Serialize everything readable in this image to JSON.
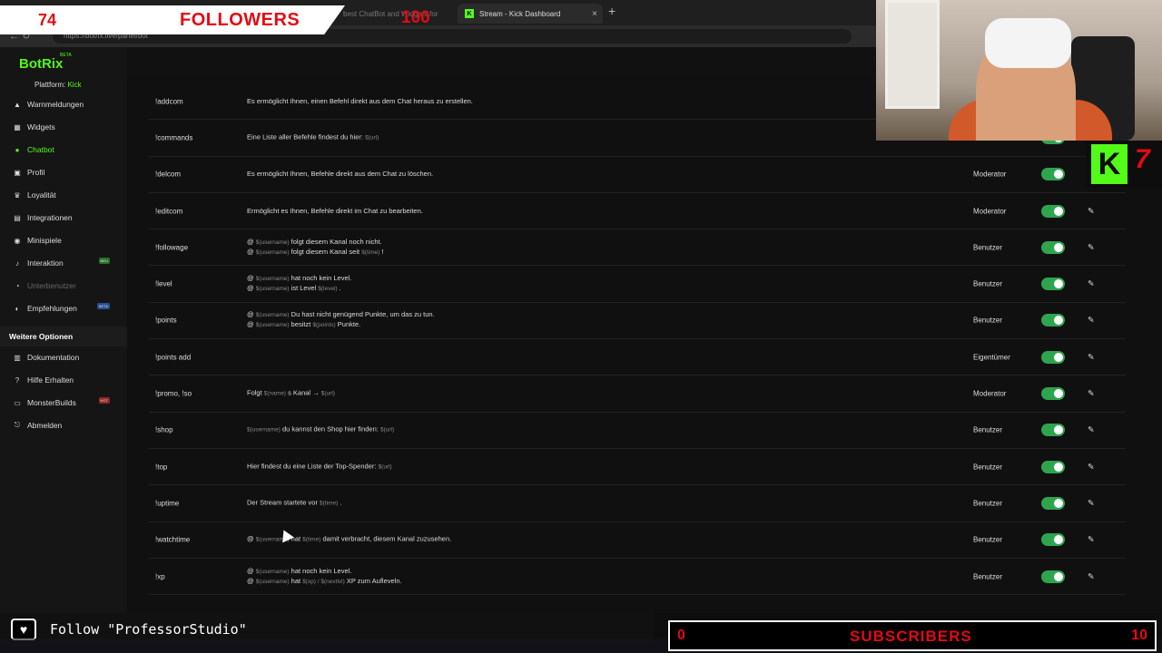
{
  "browser": {
    "tabs": [
      {
        "title": "best ChatBot and Widgets for",
        "active": false
      },
      {
        "title": "Stream - Kick Dashboard",
        "active": true
      }
    ],
    "new_tab_glyph": "+",
    "close_glyph": "×",
    "url": "https://botrix.live/panel/bot"
  },
  "followers_overlay": {
    "count": "74",
    "label": "FOLLOWERS",
    "goal": "100"
  },
  "app": {
    "logo": "BotRix",
    "logo_badge": "BETA",
    "platform_label": "Plattform:",
    "platform_value": "Kick",
    "nav": [
      {
        "label": "Warnmeldungen",
        "icon": "bell-icon",
        "glyph": "▲"
      },
      {
        "label": "Widgets",
        "icon": "grid-icon",
        "glyph": "▦"
      },
      {
        "label": "Chatbot",
        "icon": "chat-icon",
        "glyph": "●",
        "active": true
      },
      {
        "label": "Profil",
        "icon": "profile-icon",
        "glyph": "▣"
      },
      {
        "label": "Loyalität",
        "icon": "trophy-icon",
        "glyph": "♛"
      },
      {
        "label": "Integrationen",
        "icon": "integration-icon",
        "glyph": "▤"
      },
      {
        "label": "Minispiele",
        "icon": "game-icon",
        "glyph": "◉"
      },
      {
        "label": "Interaktion",
        "icon": "music-icon",
        "glyph": "♪",
        "badge": "NEU"
      },
      {
        "label": "Unterbenutzer",
        "icon": "users-icon",
        "glyph": "◔",
        "disabled": true
      },
      {
        "label": "Empfehlungen",
        "icon": "referral-icon",
        "glyph": "◐",
        "badge": "BETA"
      }
    ],
    "section_title": "Weitere Optionen",
    "more_nav": [
      {
        "label": "Dokumentation",
        "icon": "book-icon",
        "glyph": "▥"
      },
      {
        "label": "Hilfe Erhalten",
        "icon": "help-icon",
        "glyph": "?"
      },
      {
        "label": "MonsterBuilds",
        "icon": "monitor-icon",
        "glyph": "▭",
        "badge": "HOT"
      },
      {
        "label": "Abmelden",
        "icon": "logout-icon",
        "glyph": "⎋"
      }
    ]
  },
  "commands": [
    {
      "cmd": "!addcom",
      "lines": [
        [
          "Es ermöglicht Ihnen, einen Befehl direkt aus dem Chat heraus zu erstellen."
        ]
      ],
      "perm": ""
    },
    {
      "cmd": "!commands",
      "lines": [
        [
          "Eine Liste aller Befehle findest du hier: ",
          "$(url)"
        ]
      ],
      "perm": ""
    },
    {
      "cmd": "!delcom",
      "lines": [
        [
          "Es ermöglicht Ihnen, Befehle direkt aus dem Chat zu löschen."
        ]
      ],
      "perm": "Moderator"
    },
    {
      "cmd": "!editcom",
      "lines": [
        [
          "Ermöglicht es Ihnen, Befehle direkt im Chat zu bearbeiten."
        ]
      ],
      "perm": "Moderator"
    },
    {
      "cmd": "!followage",
      "lines": [
        [
          "@ ",
          "$(username)",
          " folgt diesem Kanal noch nicht."
        ],
        [
          "@ ",
          "$(username)",
          " folgt diesem Kanal seit ",
          "$(time)",
          " !"
        ]
      ],
      "perm": "Benutzer"
    },
    {
      "cmd": "!level",
      "lines": [
        [
          "@ ",
          "$(username)",
          " hat noch kein Level."
        ],
        [
          "@ ",
          "$(username)",
          " ist Level ",
          "$(level)",
          " ."
        ]
      ],
      "perm": "Benutzer"
    },
    {
      "cmd": "!points",
      "lines": [
        [
          "@ ",
          "$(username)",
          " Du hast nicht genügend Punkte, um das zu tun."
        ],
        [
          "@ ",
          "$(username)",
          " besitzt ",
          "$(points)",
          " Punkte."
        ]
      ],
      "perm": "Benutzer"
    },
    {
      "cmd": "!points add",
      "lines": [],
      "perm": "Eigentümer"
    },
    {
      "cmd": "!promo, !so",
      "lines": [
        [
          "Folgt ",
          "$(name)",
          " s Kanal → ",
          "$(url)"
        ]
      ],
      "perm": "Moderator"
    },
    {
      "cmd": "!shop",
      "lines": [
        [
          "",
          "$(username)",
          " du kannst den Shop hier finden: ",
          "$(url)"
        ]
      ],
      "perm": "Benutzer"
    },
    {
      "cmd": "!top",
      "lines": [
        [
          "Hier findest du eine Liste der Top-Spender: ",
          "$(url)"
        ]
      ],
      "perm": "Benutzer"
    },
    {
      "cmd": "!uptime",
      "lines": [
        [
          "Der Stream startete vor ",
          "$(time)",
          " ."
        ]
      ],
      "perm": "Benutzer"
    },
    {
      "cmd": "!watchtime",
      "lines": [
        [
          "@ ",
          "$(username)",
          " hat ",
          "$(time)",
          " damit verbracht, diesem Kanal zuzusehen."
        ]
      ],
      "perm": "Benutzer"
    },
    {
      "cmd": "!xp",
      "lines": [
        [
          "@ ",
          "$(username)",
          " hat noch kein Level."
        ],
        [
          "@ ",
          "$(username)",
          " hat ",
          "$(xp) / $(nextlvl)",
          " XP zum Aufleveln."
        ]
      ],
      "perm": "Benutzer"
    }
  ],
  "kick_overlay": {
    "letter": "K",
    "number": "7"
  },
  "follow_overlay": {
    "heart": "♥",
    "text": "Follow \"ProfessorStudio\""
  },
  "subs_overlay": {
    "count": "0",
    "label": "SUBSCRIBERS",
    "goal": "10"
  },
  "icons": {
    "edit": "✎",
    "refresh": "↻",
    "back": "←"
  },
  "colors": {
    "accent": "#53fc18",
    "toggle": "#2ea44f",
    "overlay_red": "#e50914"
  }
}
